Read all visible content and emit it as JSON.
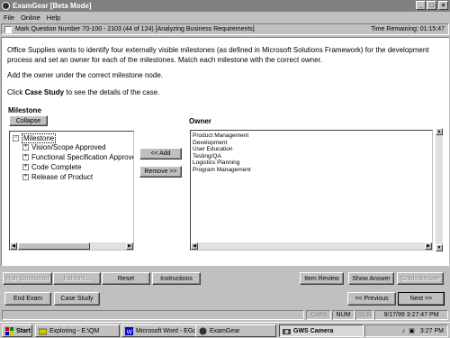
{
  "window": {
    "title": "ExamGear [Beta Mode]",
    "minimize": "_",
    "maximize": "□",
    "close": "×"
  },
  "menu": {
    "file": "File",
    "online": "Online",
    "help": "Help"
  },
  "question_bar": {
    "mark_label": "Mark Question Number 70-100 - 2103 (44 of 124) [Analyzing Business Requirements]",
    "time_label": "Time Remaining: 01:15:47"
  },
  "question": {
    "paragraph1": "Office Supplies wants to identify four externally visible milestones (as defined in Microsoft Solutions Framework) for the development process and set an owner for each of the milestones. Match each milestone with the correct owner.",
    "paragraph2": "Add the owner under the correct milestone node.",
    "paragraph3_prefix": "Click ",
    "paragraph3_bold": "Case Study",
    "paragraph3_suffix": " to see the details of the case."
  },
  "milestone_panel": {
    "label": "Milestone",
    "collapse_button": "Collapse",
    "root": "Milestone",
    "items": [
      "Vision/Scope Approved",
      "Functional Specification Approved",
      "Code Complete",
      "Release of Product"
    ]
  },
  "owner_panel": {
    "label": "Owner",
    "items": [
      "Product Management",
      "Development",
      "User Education",
      "Testing/QA",
      "Logistics Planning",
      "Program Management"
    ]
  },
  "transfer": {
    "add": "<< Add",
    "remove": "Remove >>"
  },
  "buttons": {
    "run_simulation": "Run Simulation",
    "exhibits": "Exhibits...",
    "reset": "Reset",
    "instructions": "Instructions",
    "item_review": "Item Review",
    "show_answer": "Show Answer",
    "grade_answer": "Grade Answer",
    "end_exam": "End Exam",
    "case_study": "Case Study",
    "previous": "<< Previous",
    "next": "Next >>"
  },
  "status": {
    "caps": "CAPS",
    "num": "NUM",
    "scr": "SCR",
    "datetime": "9/17/99 3:27:47 PM"
  },
  "taskbar": {
    "start": "Start",
    "tasks": [
      "Exploring - E:\\QM",
      "Microsoft Word - EGqw...",
      "GWS Camera",
      "ExamGear"
    ],
    "clock": "3:27 PM"
  }
}
